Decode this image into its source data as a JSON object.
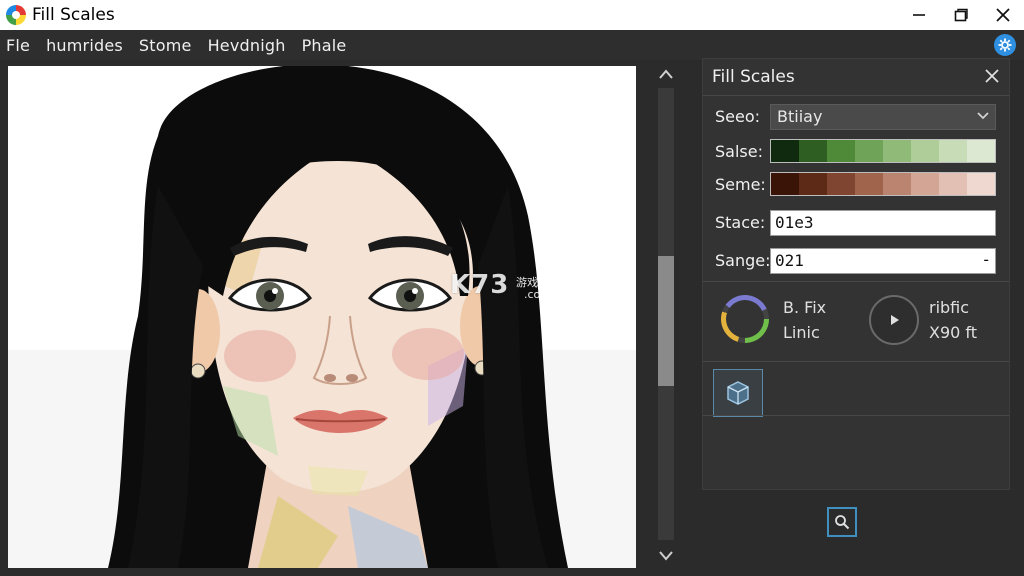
{
  "window": {
    "title": "Fill Scales",
    "minimize_icon": "minimize-icon",
    "maximize_icon": "maximize-icon",
    "close_icon": "close-icon"
  },
  "menu": {
    "items": [
      "Fle",
      "humrides",
      "Stome",
      "Hevdnigh",
      "Phale"
    ]
  },
  "panel": {
    "title": "Fill Scales",
    "fields": {
      "seed": {
        "label": "Seeo:",
        "value": "Btiiay"
      },
      "salse": {
        "label": "Salse:",
        "colors": [
          "#0f2a0f",
          "#2f5e22",
          "#4f8a39",
          "#6ea358",
          "#8fba78",
          "#aecd98",
          "#c9dcb8",
          "#dde8d2"
        ]
      },
      "seme": {
        "label": "Seme:",
        "colors": [
          "#3a1406",
          "#5c2a16",
          "#7f4530",
          "#a0644c",
          "#bb8471",
          "#d2a594",
          "#e2c1b4",
          "#eed8cf"
        ]
      },
      "stace": {
        "label": "Stace:",
        "value": "01e3"
      },
      "sange": {
        "label": "Sange:",
        "value": "021"
      }
    },
    "controls": {
      "left_line1": "B. Fix",
      "left_line2": "Linic",
      "right_line1": "ribfic",
      "right_line2": "X90 ft"
    }
  },
  "watermark": {
    "brand": "K73",
    "sub": "游戏之家",
    "domain": ".com"
  },
  "colors": {
    "accent": "#3f8fc0",
    "panel_bg": "#333333",
    "app_bg": "#2b2b2b"
  }
}
